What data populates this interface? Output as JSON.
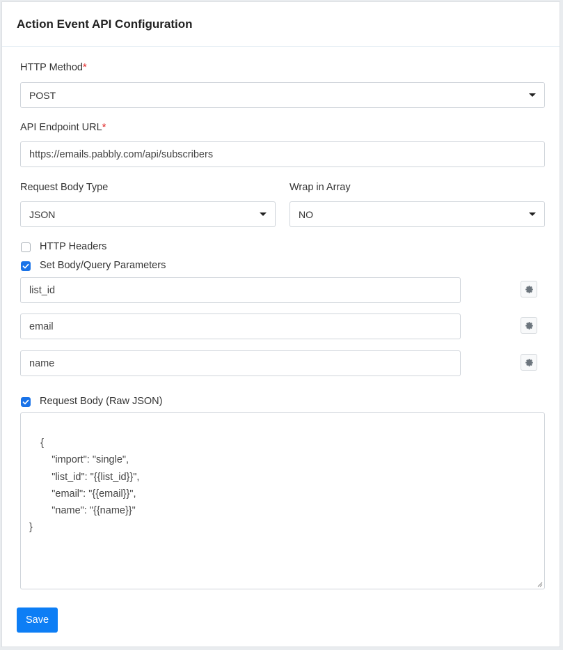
{
  "panel": {
    "title": "Action Event API Configuration"
  },
  "http_method": {
    "label": "HTTP Method",
    "required_mark": "*",
    "value": "POST"
  },
  "endpoint": {
    "label": "API Endpoint URL",
    "required_mark": "*",
    "value": "https://emails.pabbly.com/api/subscribers"
  },
  "body_type": {
    "label": "Request Body Type",
    "value": "JSON"
  },
  "wrap_array": {
    "label": "Wrap in Array",
    "value": "NO"
  },
  "http_headers": {
    "label": "HTTP Headers",
    "checked": false
  },
  "set_params": {
    "label": "Set Body/Query Parameters",
    "checked": true,
    "params": [
      {
        "value": "list_id"
      },
      {
        "value": "email"
      },
      {
        "value": "name"
      }
    ]
  },
  "raw_body": {
    "label": "Request Body (Raw JSON)",
    "checked": true,
    "value": "{\n        \"import\": \"single\",\n        \"list_id\": \"{{list_id}}\",\n        \"email\": \"{{email}}\",\n        \"name\": \"{{name}}\"\n}"
  },
  "actions": {
    "save_label": "Save"
  },
  "colors": {
    "primary": "#0d7ef5",
    "checkbox_checked": "#1a73e8",
    "required": "#e02424"
  }
}
